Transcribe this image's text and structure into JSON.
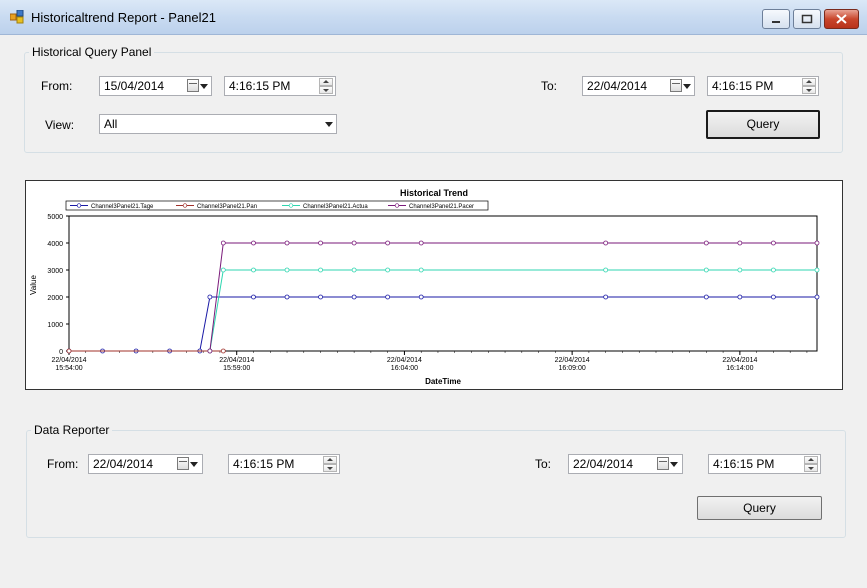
{
  "window": {
    "title": "Historicaltrend Report - Panel21"
  },
  "query_panel": {
    "title": "Historical Query Panel",
    "from_label": "From:",
    "from_date": "15/04/2014",
    "from_time": "4:16:15 PM",
    "to_label": "To:",
    "to_date": "22/04/2014",
    "to_time": "4:16:15 PM",
    "view_label": "View:",
    "view_value": "All",
    "query_label": "Query"
  },
  "data_reporter": {
    "title": "Data Reporter",
    "from_label": "From:",
    "from_date": "22/04/2014",
    "from_time": "4:16:15 PM",
    "to_label": "To:",
    "to_date": "22/04/2014",
    "to_time": "4:16:15 PM",
    "query_label": "Query"
  },
  "chart_data": {
    "type": "line",
    "title": "Historical Trend",
    "xlabel": "DateTime",
    "ylabel": "Value",
    "ylim": [
      0,
      5000
    ],
    "y_ticks": [
      0,
      1000,
      2000,
      3000,
      4000,
      5000
    ],
    "x_ticks": [
      {
        "date": "22/04/2014",
        "time": "15:54:00",
        "t": 0
      },
      {
        "date": "22/04/2014",
        "time": "15:59:00",
        "t": 5
      },
      {
        "date": "22/04/2014",
        "time": "16:04:00",
        "t": 10
      },
      {
        "date": "22/04/2014",
        "time": "16:09:00",
        "t": 15
      },
      {
        "date": "22/04/2014",
        "time": "16:14:00",
        "t": 20
      }
    ],
    "xlim": [
      0,
      22.3
    ],
    "legend_position": "top",
    "series": [
      {
        "name": "Channel3Panel21.Tage",
        "color": "#1a1aa6",
        "x": [
          0,
          1,
          2,
          3,
          3.9,
          4.2,
          5.5,
          6.5,
          7.5,
          8.5,
          9.5,
          10.5,
          16,
          19,
          20,
          21,
          22.3
        ],
        "y": [
          0,
          0,
          0,
          0,
          0,
          2000,
          2000,
          2000,
          2000,
          2000,
          2000,
          2000,
          2000,
          2000,
          2000,
          2000,
          2000
        ]
      },
      {
        "name": "Channel3Panel21.Pan",
        "color": "#a0302a",
        "x": [
          0,
          4.2,
          4.6
        ],
        "y": [
          0,
          0,
          0
        ]
      },
      {
        "name": "Channel3Panel21.Actua",
        "color": "#2fd6b0",
        "x": [
          4.2,
          4.6,
          5.5,
          6.5,
          7.5,
          8.5,
          9.5,
          10.5,
          16,
          19,
          20,
          21,
          22.3
        ],
        "y": [
          0,
          3000,
          3000,
          3000,
          3000,
          3000,
          3000,
          3000,
          3000,
          3000,
          3000,
          3000,
          3000
        ]
      },
      {
        "name": "Channel3Panel21.Pacer",
        "color": "#7a1a7a",
        "x": [
          4.2,
          4.6,
          5.5,
          6.5,
          7.5,
          8.5,
          9.5,
          10.5,
          16,
          19,
          20,
          21,
          22.3
        ],
        "y": [
          0,
          4000,
          4000,
          4000,
          4000,
          4000,
          4000,
          4000,
          4000,
          4000,
          4000,
          4000,
          4000
        ]
      }
    ]
  }
}
